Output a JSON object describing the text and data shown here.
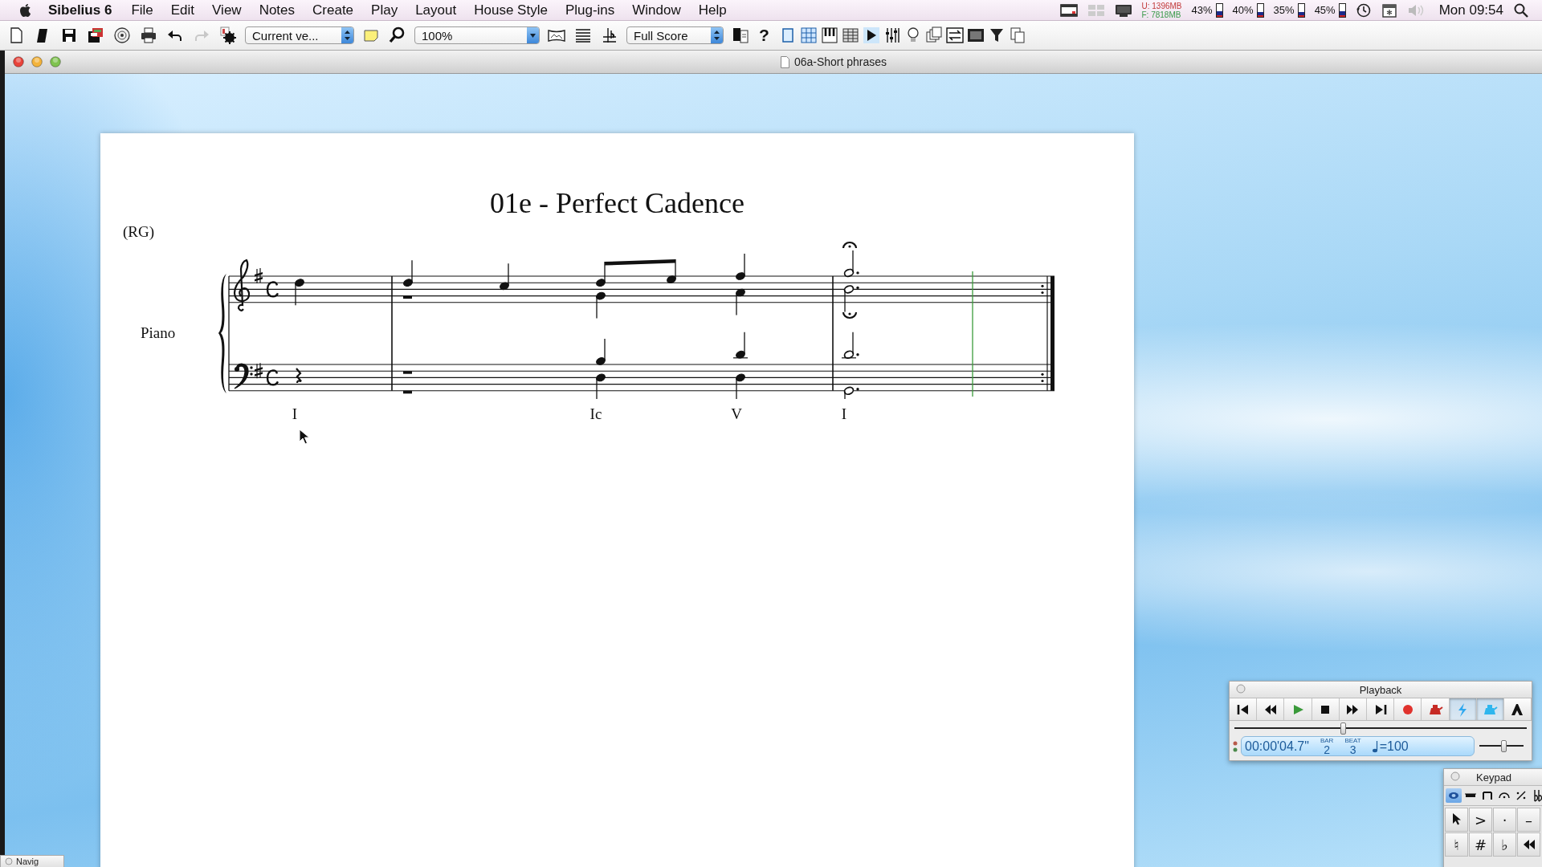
{
  "menu_bar": {
    "app": "Sibelius 6",
    "items": [
      "File",
      "Edit",
      "View",
      "Notes",
      "Create",
      "Play",
      "Layout",
      "House Style",
      "Plug-ins",
      "Window",
      "Help"
    ],
    "memory": {
      "used": "U: 1396MB",
      "free": "F: 7818MB"
    },
    "meters": [
      {
        "reading": "43%",
        "level": 0.43
      },
      {
        "reading": "40%",
        "level": 0.4
      },
      {
        "reading": "35%",
        "level": 0.35
      },
      {
        "reading": "45%",
        "level": 0.45
      }
    ],
    "clock": "Mon 09:54"
  },
  "toolbar": {
    "redo": {
      "disabled": true
    },
    "version_select": "Current ve...",
    "zoom_select": "100%",
    "view_select": "Full Score",
    "help": "?"
  },
  "document": {
    "title": "06a-Short phrases",
    "score": {
      "title": "01e - Perfect Cadence",
      "composer": "(RG)",
      "instrument": "Piano",
      "chords": [
        "I",
        "Ic",
        "V",
        "I"
      ]
    }
  },
  "playback": {
    "title": "Playback",
    "buttons": [
      {
        "on": false
      },
      {
        "on": false
      },
      {
        "on": false
      },
      {
        "on": false
      },
      {
        "on": false
      },
      {
        "on": false
      },
      {
        "on": false
      },
      {
        "on": false
      },
      {
        "on": true
      },
      {
        "on": true
      },
      {
        "on": false
      }
    ],
    "position": {
      "level": 0.37
    },
    "time": "00:00'04.7\"",
    "bar_label": "BAR",
    "bar": "2",
    "beat_label": "BEAT",
    "beat": "3",
    "tempo": "=100",
    "tempo_slider": {
      "level": 0.54
    }
  },
  "keypad": {
    "title": "Keypad",
    "tabs": [
      {
        "selected": true
      },
      {
        "selected": false
      },
      {
        "selected": false
      },
      {
        "selected": false
      },
      {
        "selected": false
      },
      {
        "selected": false
      }
    ],
    "keys": [
      {
        "kind": "icon"
      },
      {
        "kind": "text",
        "label": ">"
      },
      {
        "kind": "text",
        "label": "·"
      },
      {
        "kind": "text",
        "label": "–"
      },
      {
        "kind": "text",
        "label": "♮"
      },
      {
        "kind": "text",
        "label": "#"
      },
      {
        "kind": "text",
        "label": "♭"
      },
      {
        "kind": "icon"
      }
    ]
  },
  "navigator": {
    "title": "Navig"
  }
}
